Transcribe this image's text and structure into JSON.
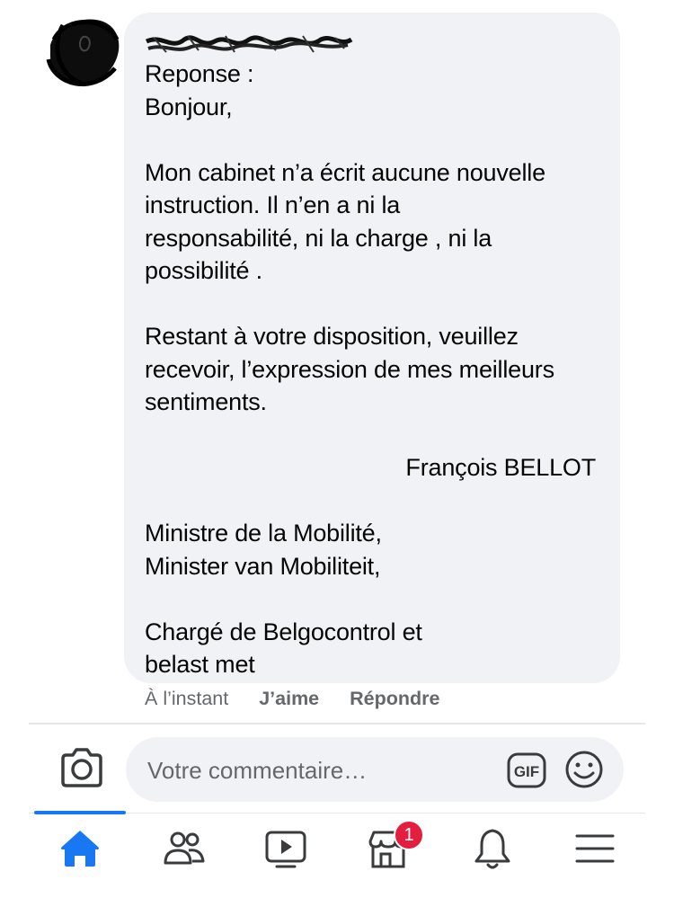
{
  "comment": {
    "author_redacted": "",
    "lines": [
      "Reponse :",
      "Bonjour,",
      "",
      "Mon cabinet n’a écrit aucune nouvelle",
      "instruction. Il n’en a ni la",
      "responsabilité, ni la charge , ni la",
      "possibilité .",
      "",
      "Restant à votre disposition, veuillez",
      "recevoir, l’expression de mes meilleurs",
      "sentiments."
    ],
    "signature": "François BELLOT",
    "title_lines": [
      "Ministre de la Mobilité,",
      "Minister van Mobiliteit,",
      "",
      "Chargé de Belgocontrol et",
      "belast met"
    ]
  },
  "meta": {
    "time": "À l’instant",
    "like": "J’aime",
    "reply": "Répondre"
  },
  "composer": {
    "placeholder": "Votre commentaire…",
    "gif_label": "GIF"
  },
  "tabs": [
    {
      "name": "home",
      "icon": "home-icon",
      "active": true
    },
    {
      "name": "friends",
      "icon": "friends-icon"
    },
    {
      "name": "watch",
      "icon": "video-icon"
    },
    {
      "name": "marketplace",
      "icon": "marketplace-icon",
      "badge": "1"
    },
    {
      "name": "notifications",
      "icon": "bell-icon"
    },
    {
      "name": "menu",
      "icon": "menu-icon"
    }
  ],
  "colors": {
    "accent": "#1877f2",
    "bubble": "#f0f2f5",
    "badge": "#e41e3f",
    "meta": "#65676b"
  }
}
